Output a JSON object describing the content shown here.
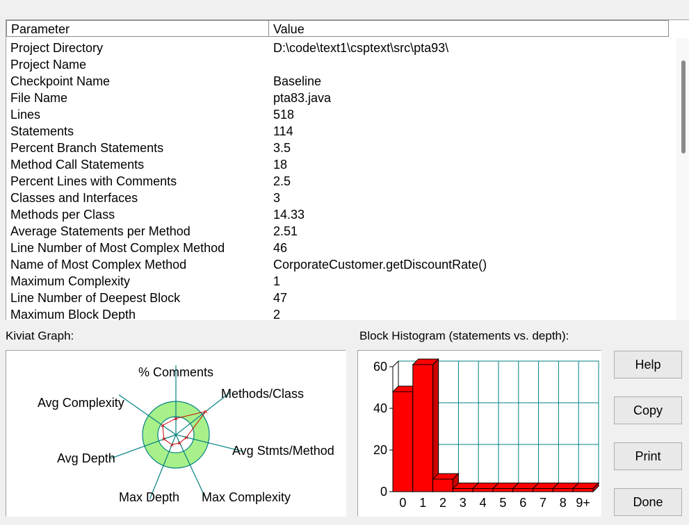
{
  "table": {
    "columns": [
      "Parameter",
      "Value"
    ],
    "rows": [
      {
        "param": "Project Directory",
        "value": "D:\\code\\text1\\csptext\\src\\pta93\\"
      },
      {
        "param": "Project Name",
        "value": ""
      },
      {
        "param": "Checkpoint Name",
        "value": "Baseline"
      },
      {
        "param": "File Name",
        "value": "pta83.java"
      },
      {
        "param": "Lines",
        "value": "518"
      },
      {
        "param": "Statements",
        "value": "114"
      },
      {
        "param": "Percent Branch Statements",
        "value": "3.5"
      },
      {
        "param": "Method Call Statements",
        "value": "18"
      },
      {
        "param": "Percent Lines with Comments",
        "value": "2.5"
      },
      {
        "param": "Classes and Interfaces",
        "value": "3"
      },
      {
        "param": "Methods per Class",
        "value": "14.33"
      },
      {
        "param": "Average Statements per Method",
        "value": "2.51"
      },
      {
        "param": "Line Number of Most Complex Method",
        "value": "46"
      },
      {
        "param": "Name of Most Complex Method",
        "value": "CorporateCustomer.getDiscountRate()"
      },
      {
        "param": "Maximum Complexity",
        "value": "1"
      },
      {
        "param": "Line Number of Deepest Block",
        "value": "47"
      },
      {
        "param": "Maximum Block Depth",
        "value": "2"
      }
    ]
  },
  "kiviat": {
    "title": "Kiviat Graph:",
    "axes": [
      "% Comments",
      "Methods/Class",
      "Avg Stmts/Method",
      "Max Complexity",
      "Max Depth",
      "Avg Depth",
      "Avg Complexity"
    ],
    "ring_color": "#a8f08a",
    "values": [
      0.45,
      1.05,
      0.3,
      0.25,
      0.3,
      0.35,
      0.45
    ]
  },
  "histogram": {
    "title": "Block Histogram (statements vs. depth):",
    "bar_color": "#ff0000",
    "grid_color": "#008080"
  },
  "chart_data": {
    "type": "bar",
    "categories": [
      "0",
      "1",
      "2",
      "3",
      "4",
      "5",
      "6",
      "7",
      "8",
      "9+"
    ],
    "values": [
      48,
      61,
      6,
      0,
      0,
      0,
      0,
      0,
      0,
      0
    ],
    "ylim": [
      0,
      60
    ],
    "yticks": [
      0,
      20,
      40,
      60
    ],
    "grid": true
  },
  "buttons": {
    "help": "Help",
    "copy": "Copy",
    "print": "Print",
    "done": "Done"
  }
}
